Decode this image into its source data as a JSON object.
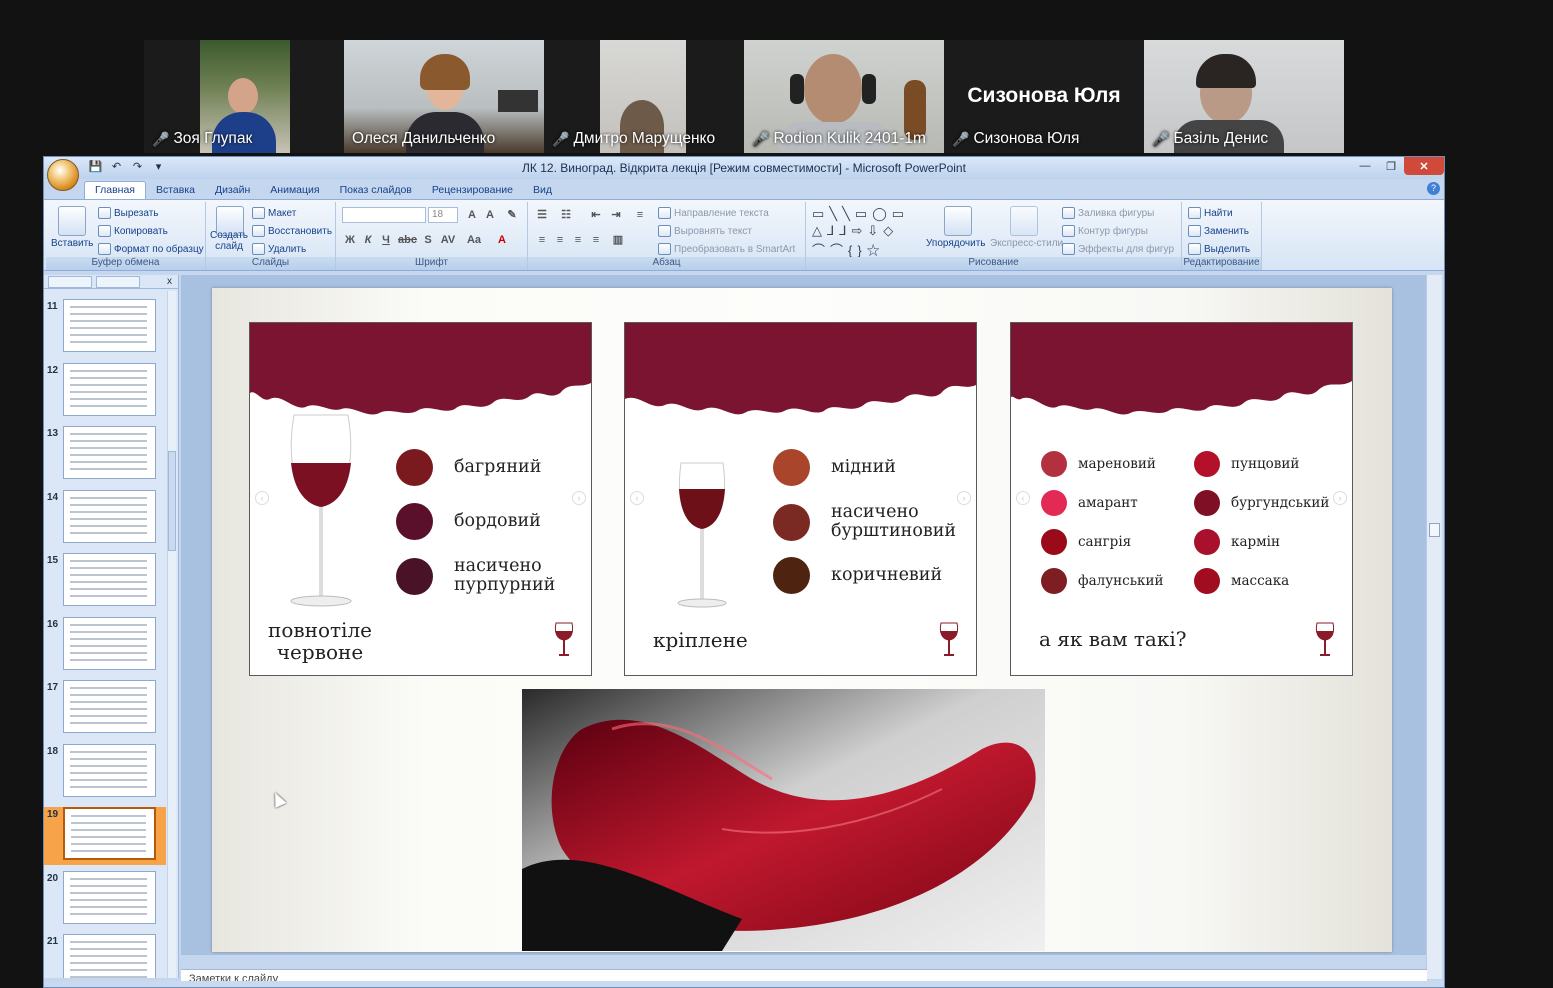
{
  "participants": [
    {
      "name": "Зоя Глупак",
      "muted": true
    },
    {
      "name": "Олеся Данильченко",
      "muted": false,
      "active": true
    },
    {
      "name": "Дмитро Марущенко",
      "muted": true
    },
    {
      "name": "Rodion Kulik 2401-1m",
      "muted": true
    },
    {
      "name": "Сизонова Юля",
      "muted": true,
      "display_name": "Сизонова Юля"
    },
    {
      "name": "Базіль Денис",
      "muted": true
    }
  ],
  "window": {
    "title": "ЛК 12. Виноград. Відкрита лекція [Режим совместимости] - Microsoft PowerPoint"
  },
  "tabs": [
    "Главная",
    "Вставка",
    "Дизайн",
    "Анимация",
    "Показ слайдов",
    "Рецензирование",
    "Вид"
  ],
  "ribbon": {
    "clipboard": {
      "label": "Буфер обмена",
      "paste": "Вставить",
      "cut": "Вырезать",
      "copy": "Копировать",
      "format_painter": "Формат по образцу"
    },
    "slides": {
      "label": "Слайды",
      "new_slide": "Создать слайд",
      "layout": "Макет",
      "reset": "Восстановить",
      "delete": "Удалить"
    },
    "font": {
      "label": "Шрифт",
      "size": "18"
    },
    "paragraph": {
      "label": "Абзац",
      "text_direction": "Направление текста",
      "align_text": "Выровнять текст",
      "smartart": "Преобразовать в SmartArt"
    },
    "drawing": {
      "label": "Рисование",
      "arrange": "Упорядочить",
      "quick_styles": "Экспресс-стили",
      "fill": "Заливка фигуры",
      "outline": "Контур фигуры",
      "effects": "Эффекты для фигур"
    },
    "editing": {
      "label": "Редактирование",
      "find": "Найти",
      "replace": "Заменить",
      "select": "Выделить"
    }
  },
  "thumbnails": [
    {
      "num": "11"
    },
    {
      "num": "12"
    },
    {
      "num": "13"
    },
    {
      "num": "14"
    },
    {
      "num": "15"
    },
    {
      "num": "16"
    },
    {
      "num": "17"
    },
    {
      "num": "18"
    },
    {
      "num": "19",
      "selected": true
    },
    {
      "num": "20"
    },
    {
      "num": "21"
    }
  ],
  "slide": {
    "card1": {
      "items": [
        {
          "label": "багряний",
          "color": "#7a1a1f"
        },
        {
          "label": "бордовий",
          "color": "#5a0f2a"
        },
        {
          "label": "насичено пурпурний",
          "color": "#4a1226"
        }
      ],
      "caption": "повнотіле червоне"
    },
    "card2": {
      "items": [
        {
          "label": "мідний",
          "color": "#a8452a"
        },
        {
          "label": "насичено бурштиновий",
          "color": "#7a2a22"
        },
        {
          "label": "коричневий",
          "color": "#4e2410"
        }
      ],
      "caption": "кріплене"
    },
    "card3": {
      "items": [
        {
          "label": "мареновий",
          "color": "#b3303e"
        },
        {
          "label": "пунцовий",
          "color": "#b5102a"
        },
        {
          "label": "амарант",
          "color": "#e22a54"
        },
        {
          "label": "бургундський",
          "color": "#7e0f24"
        },
        {
          "label": "сангрія",
          "color": "#9b0a18"
        },
        {
          "label": "кармін",
          "color": "#a8102c"
        },
        {
          "label": "фалунський",
          "color": "#7e1e22"
        },
        {
          "label": "массака",
          "color": "#a00c20"
        }
      ],
      "caption": "а як вам такі?"
    }
  },
  "notes": {
    "placeholder": "Заметки к слайду"
  },
  "colors": {
    "wine_splash": "#7a1430",
    "active_speaker": "#20c07a"
  }
}
